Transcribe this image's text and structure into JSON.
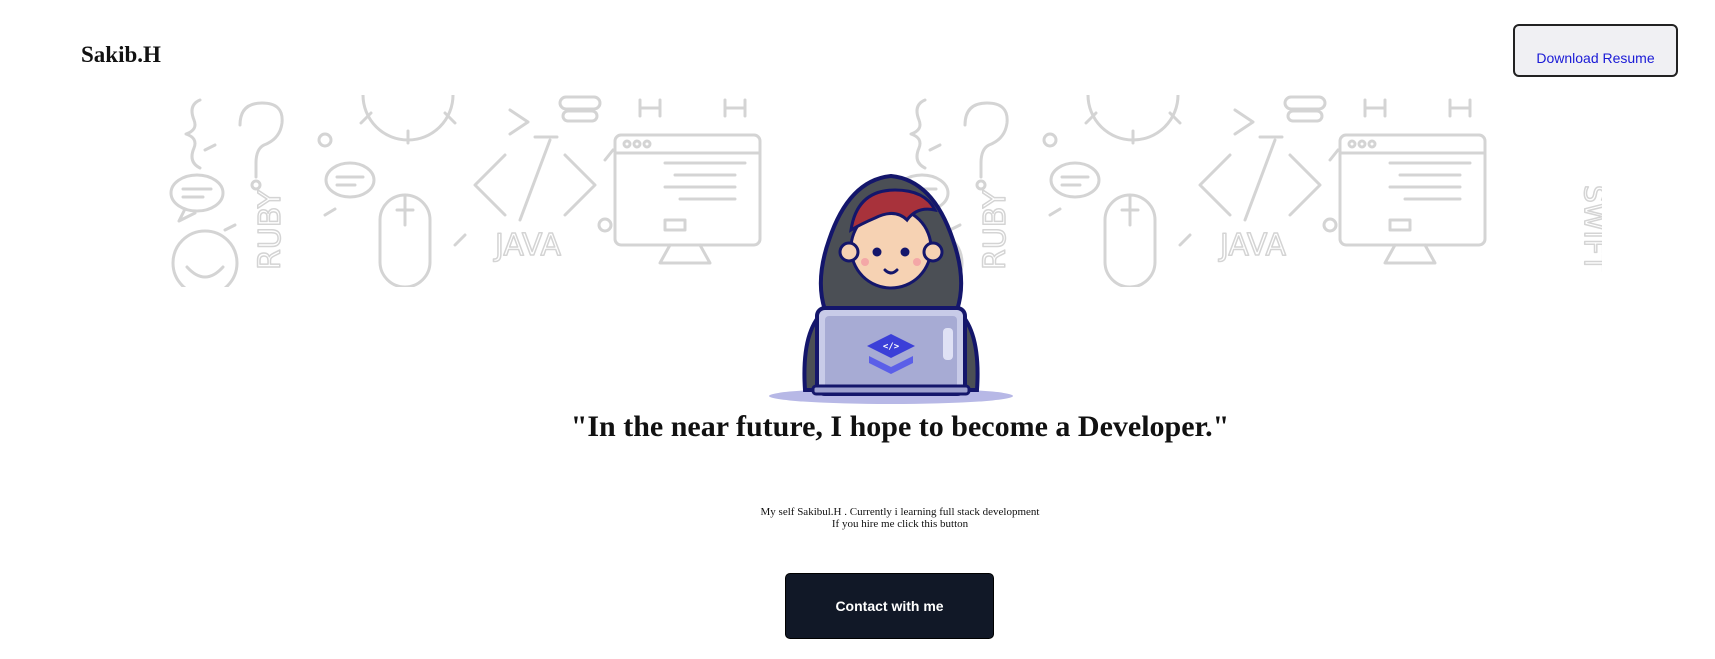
{
  "header": {
    "brand": "Sakib.H",
    "resume_button": "Download Resume"
  },
  "banner": {
    "doodle_text": [
      "JAVA",
      "RUBY",
      "SWIFT"
    ],
    "icons": [
      "curly-braces-icon",
      "question-mark-icon",
      "gear-icon",
      "terminal-prompt-icon",
      "lightbulb-icon",
      "code-tag-icon",
      "browser-window-icon",
      "monitor-icon",
      "computer-mouse-icon",
      "chat-bubble-icon",
      "smiley-icon"
    ]
  },
  "hero": {
    "illustration": "developer-with-laptop-illustration",
    "headline": "\"In the near future, I hope to become a Developer.\"",
    "description_line1": "My self Sakibul.H . Currently i learning full stack development",
    "description_line2": "If you hire me click this button",
    "contact_button": "Contact with me"
  },
  "colors": {
    "contact_button_bg": "#111827",
    "resume_button_text": "#1a1ad6",
    "doodle_stroke": "#d4d4d4",
    "hood": "#4b4f55",
    "hair": "#a8323b",
    "laptop": "#c8cbe8",
    "accent": "#3b3fd8"
  }
}
